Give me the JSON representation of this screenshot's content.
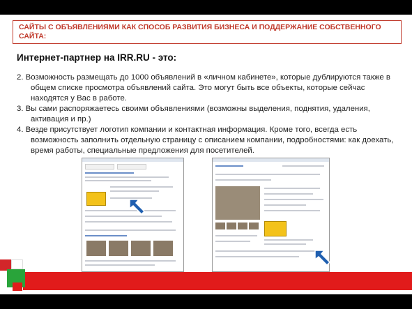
{
  "slide": {
    "title": "САЙТЫ С ОБЪЯВЛЕНИЯМИ КАК СПОСОБ РАЗВИТИЯ БИЗНЕСА И ПОДДЕРЖАНИЕ СОБСТВЕННОГО САЙТА:",
    "heading": "Интернет-партнер на IRR.RU - это:",
    "points": [
      "2. Возможность размещать до 1000 объявлений в «личном кабинете», которые дублируются также в общем списке просмотра объявлений сайта. Это могут быть все объекты, которые сейчас находятся у Вас в работе.",
      "3. Вы сами распоряжаетесь своими объявлениями (возможны выделения, поднятия, удаления, активация и пр.)",
      "4. Везде присутствует логотип компании и контактная информация. Кроме того, всегда есть возможность заполнить отдельную страницу с описанием компании, подробностями: как доехать, время работы, специальные предложения для посетителей."
    ]
  },
  "colors": {
    "accent_red": "#c0392b",
    "strip_red": "#e11b1b",
    "green": "#29a43a",
    "arrow_blue": "#1f5fb0"
  }
}
